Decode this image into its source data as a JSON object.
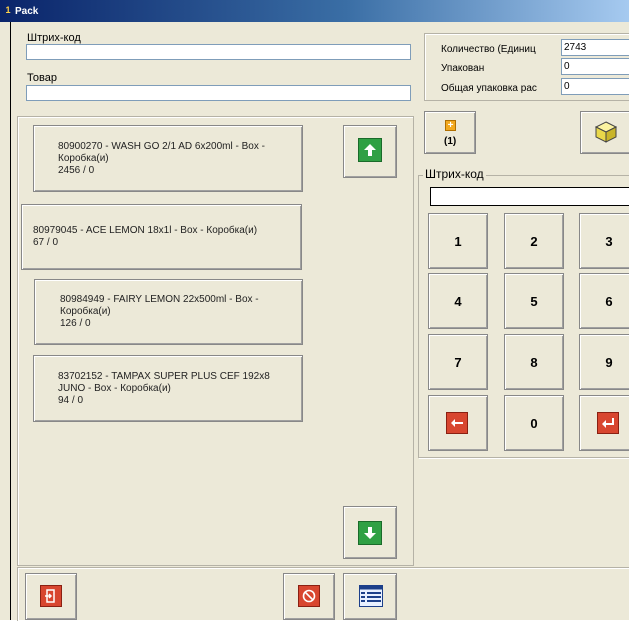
{
  "window": {
    "title": "Pack"
  },
  "top_fields": {
    "barcode_label": "Штрих-код",
    "barcode_value": "",
    "product_label": "Товар",
    "product_value": ""
  },
  "qty_panel": {
    "quantity_label": "Количество (Единиц",
    "quantity_value": "2743",
    "packed_label": "Упакован",
    "packed_value": "0",
    "total_label": "Общая упаковка рас",
    "total_value": "0"
  },
  "items": [
    {
      "line1": "80900270 - WASH  GO 2/1 AD 6x200ml - Box -",
      "line2": "Коробка(и)",
      "line3": "2456 / 0"
    },
    {
      "line1": "80979045 - ACE LEMON 18x1l - Box - Коробка(и)",
      "line2": "67 / 0",
      "line3": ""
    },
    {
      "line1": "80984949 - FAIRY LEMON 22x500ml - Box -",
      "line2": "Коробка(и)",
      "line3": "126 / 0"
    },
    {
      "line1": "83702152 - TAMPAX SUPER PLUS CEF 192x8",
      "line2": "JUNO - Box - Коробка(и)",
      "line3": "94 / 0"
    }
  ],
  "scroll": {
    "up_icon": "arrow-up",
    "down_icon": "arrow-down"
  },
  "add_button": {
    "count_label": "(1)",
    "icon": "plus-box"
  },
  "box_button": {
    "icon": "cube"
  },
  "keypad": {
    "group_label": "Штрих-код",
    "input_value": "",
    "keys": [
      "1",
      "2",
      "3",
      "4",
      "5",
      "6",
      "7",
      "8",
      "9",
      "0"
    ]
  },
  "bottom_toolbar": {
    "exit_icon": "exit-door",
    "cancel_icon": "no-sign",
    "list_icon": "list-table"
  },
  "colors": {
    "title_gradient_start": "#0a246a",
    "accent_green": "#2fa044",
    "accent_red": "#d8462f"
  }
}
